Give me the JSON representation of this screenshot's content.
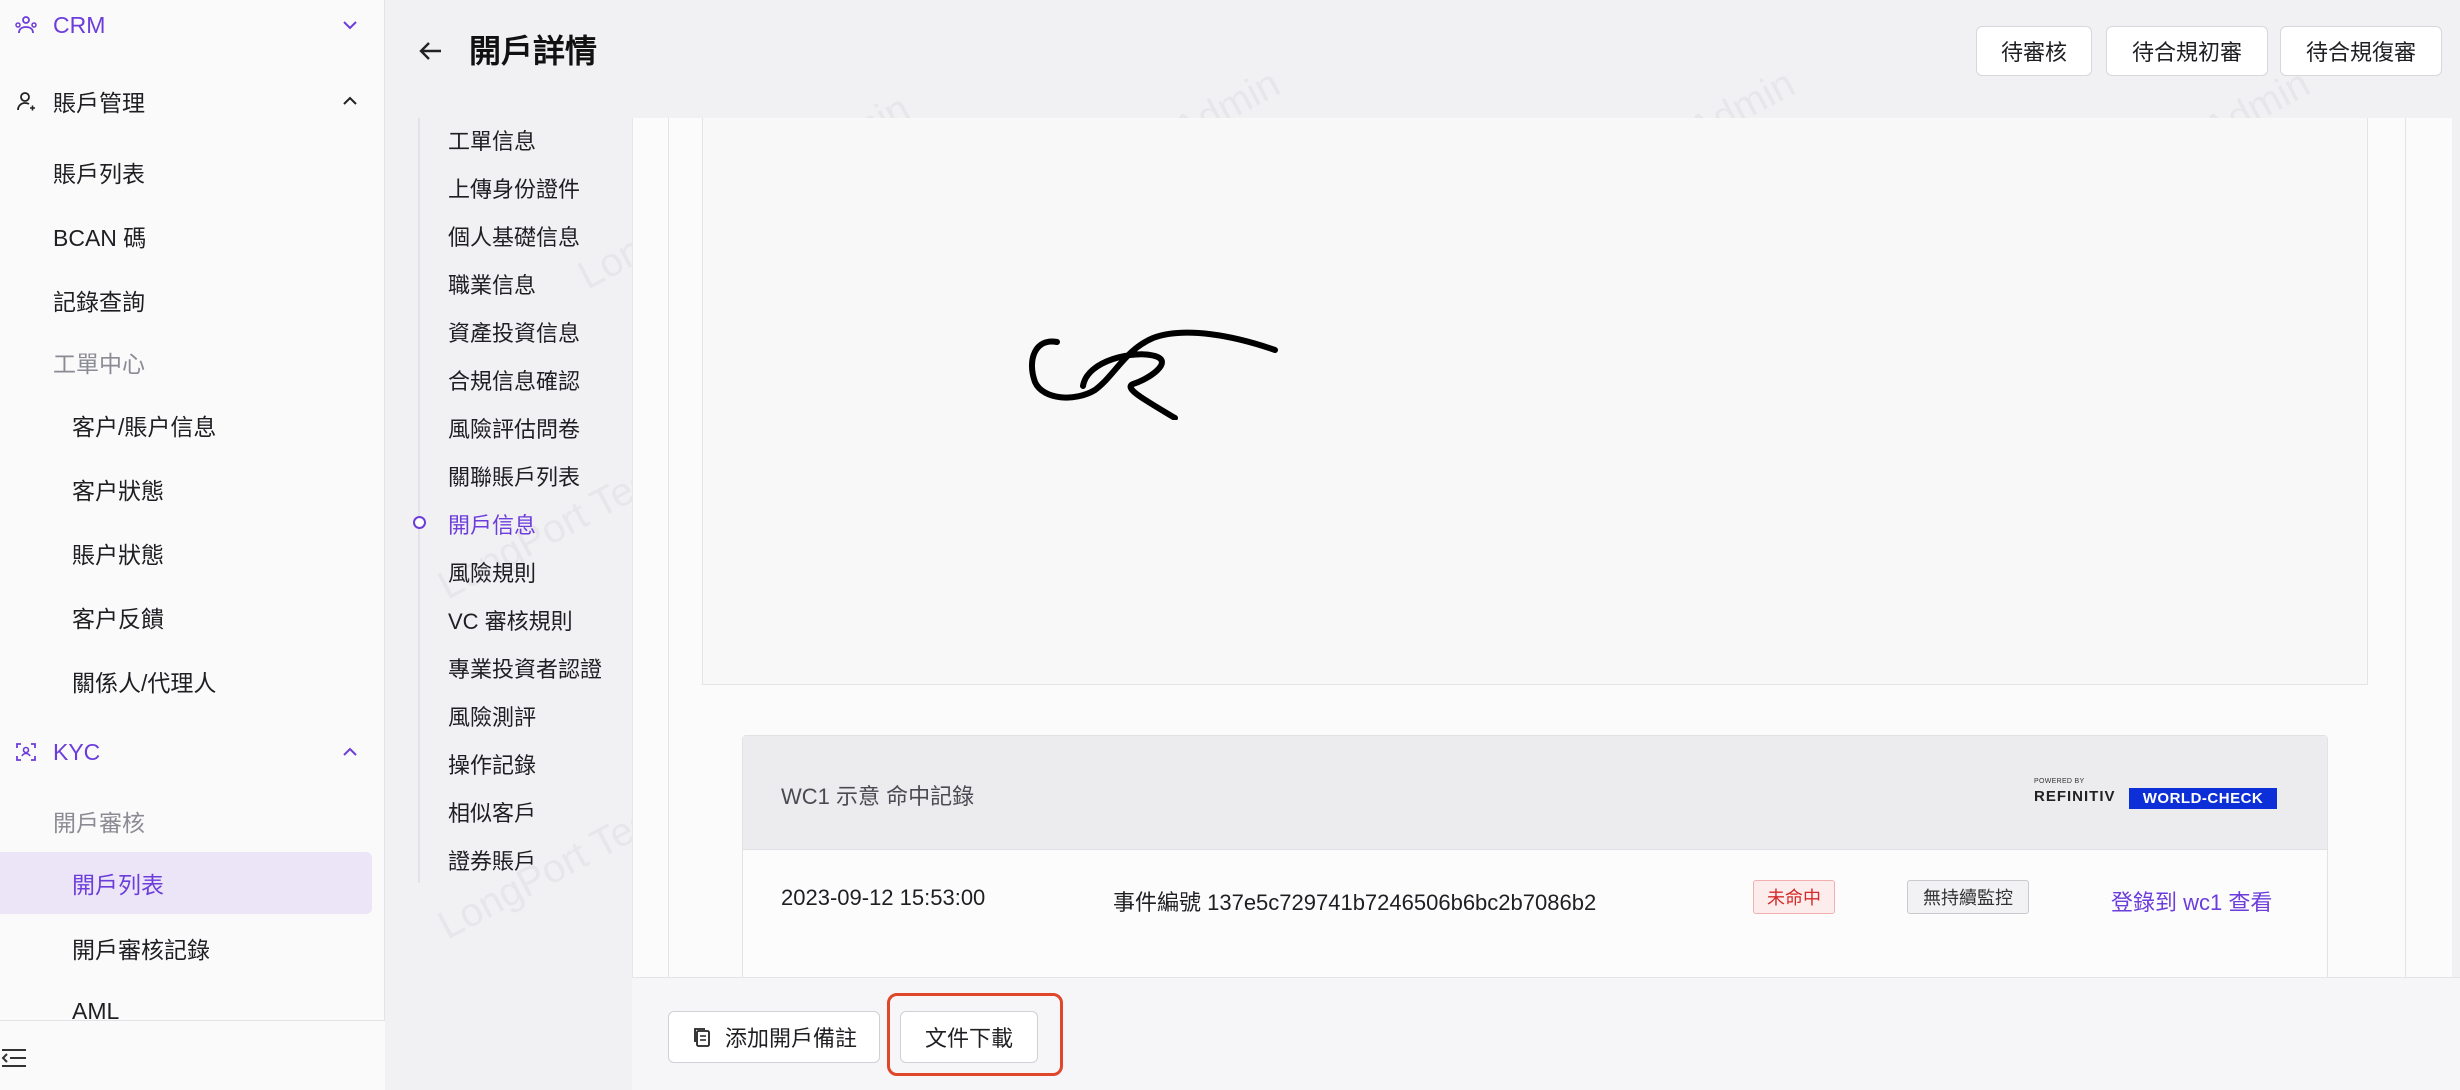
{
  "sidebar": {
    "crm": "CRM",
    "account_mgmt": "賬戶管理",
    "items_account": [
      "賬戶列表",
      "BCAN 碼",
      "記錄查詢"
    ],
    "ticket_center": "工單中心",
    "items_ticket": [
      "客户/賬户信息",
      "客户狀態",
      "賬户狀態",
      "客户反饋",
      "關係人/代理人"
    ],
    "kyc": "KYC",
    "open_review": "開戶審核",
    "items_kyc": [
      "開戶列表",
      "開戶審核記錄",
      "AML"
    ]
  },
  "header": {
    "title": "開戶詳情",
    "btn_pending": "待審核",
    "btn_compliance_first": "待合規初審",
    "btn_compliance_second": "待合規復審"
  },
  "anchor_nav": [
    "工單信息",
    "上傳身份證件",
    "個人基礎信息",
    "職業信息",
    "資產投資信息",
    "合規信息確認",
    "風險評估問卷",
    "關聯賬戶列表",
    "開戶信息",
    "風險規則",
    "VC 審核規則",
    "專業投資者認證",
    "風險測評",
    "操作記錄",
    "相似客戶",
    "證券賬戶"
  ],
  "anchor_active_index": 8,
  "wc": {
    "title": "WC1 示意 命中記錄",
    "logo_powered": "POWERED BY",
    "logo_refinitiv": "REFINITIV",
    "logo_worldcheck": "WORLD-CHECK",
    "date": "2023-09-12 15:53:00",
    "event": "事件編號 137e5c729741b7246506b6bc2b7086b2",
    "badge_hit": "未命中",
    "badge_monitor": "無持續監控",
    "link": "登錄到 wc1 查看"
  },
  "footer": {
    "add_note": "添加開戶備註",
    "download": "文件下載"
  },
  "watermark": "LongPort Test Admin",
  "colors": {
    "accent": "#6c3ddb",
    "highlight": "#e0462a",
    "wc_blue": "#0c2fd8"
  }
}
